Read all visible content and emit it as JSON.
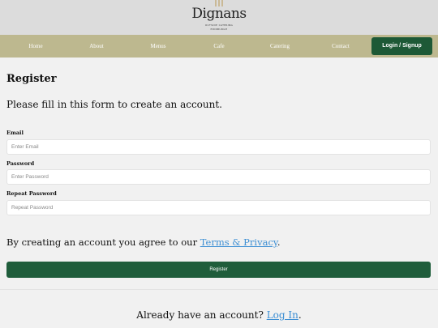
{
  "brand": {
    "name": "Dignans",
    "tagline": "Outside Catering",
    "location": "Edinburgh"
  },
  "nav": {
    "items": [
      "Home",
      "About",
      "Menus",
      "Cafe",
      "Catering",
      "Contact"
    ],
    "login_label": "Login / Signup"
  },
  "form": {
    "title": "Register",
    "intro": "Please fill in this form to create an account.",
    "email_label": "Email",
    "email_placeholder": "Enter Email",
    "password_label": "Password",
    "password_placeholder": "Enter Password",
    "repeat_label": "Repeat Password",
    "repeat_placeholder": "Repeat Password",
    "terms_prefix": "By creating an account you agree to our ",
    "terms_link": "Terms & Privacy",
    "terms_suffix": ".",
    "register_label": "Register"
  },
  "signin": {
    "prefix": "Already have an account? ",
    "link": "Log In",
    "suffix": "."
  },
  "colors": {
    "nav_bg": "#bdb88f",
    "primary_green": "#1d5936",
    "link_blue": "#3d8fd4"
  }
}
